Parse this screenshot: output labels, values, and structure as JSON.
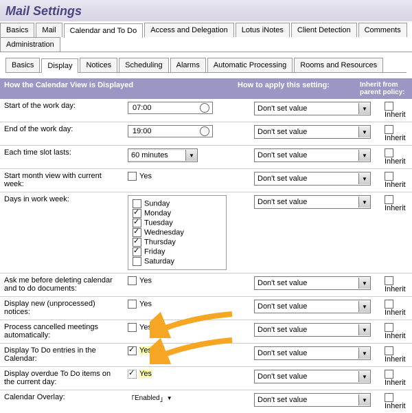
{
  "page_title": "Mail Settings",
  "tabs_main": [
    "Basics",
    "Mail",
    "Calendar and To Do",
    "Access and Delegation",
    "Lotus iNotes",
    "Client Detection",
    "Comments",
    "Administration"
  ],
  "tabs_main_active": 2,
  "tabs_sub": [
    "Basics",
    "Display",
    "Notices",
    "Scheduling",
    "Alarms",
    "Automatic Processing",
    "Rooms and Resources"
  ],
  "tabs_sub_active": 1,
  "section": {
    "col1": "How the Calendar View is Displayed",
    "col2": "How to apply this setting:",
    "col3": "Inherit from parent policy:"
  },
  "dont_set": "Don't set value",
  "inherit": "Inherit",
  "yes": "Yes",
  "rows": {
    "start": {
      "label": "Start of the work day:",
      "value": "07:00"
    },
    "end": {
      "label": "End of the work day:",
      "value": "19:00"
    },
    "slot": {
      "label": "Each time slot lasts:",
      "value": "60 minutes"
    },
    "startmonth": {
      "label": "Start month view with current week:",
      "checked": false
    },
    "days": {
      "label": "Days in work week:",
      "items": [
        {
          "name": "Sunday",
          "checked": false
        },
        {
          "name": "Monday",
          "checked": true
        },
        {
          "name": "Tuesday",
          "checked": true
        },
        {
          "name": "Wednesday",
          "checked": true
        },
        {
          "name": "Thursday",
          "checked": true
        },
        {
          "name": "Friday",
          "checked": true
        },
        {
          "name": "Saturday",
          "checked": false
        }
      ]
    },
    "askdel": {
      "label": "Ask me before deleting calendar and to do documents:",
      "checked": false
    },
    "dispnew": {
      "label": "Display new (unprocessed) notices:",
      "checked": false
    },
    "proccancel": {
      "label": "Process cancelled meetings automatically:",
      "checked": false
    },
    "disptodo": {
      "label": "Display To Do entries in the Calendar:",
      "checked": true
    },
    "dispoverdue": {
      "label": "Display overdue To Do items on the current day:",
      "checked": true
    },
    "overlay": {
      "label": "Calendar Overlay:",
      "value": "Enabled"
    }
  }
}
